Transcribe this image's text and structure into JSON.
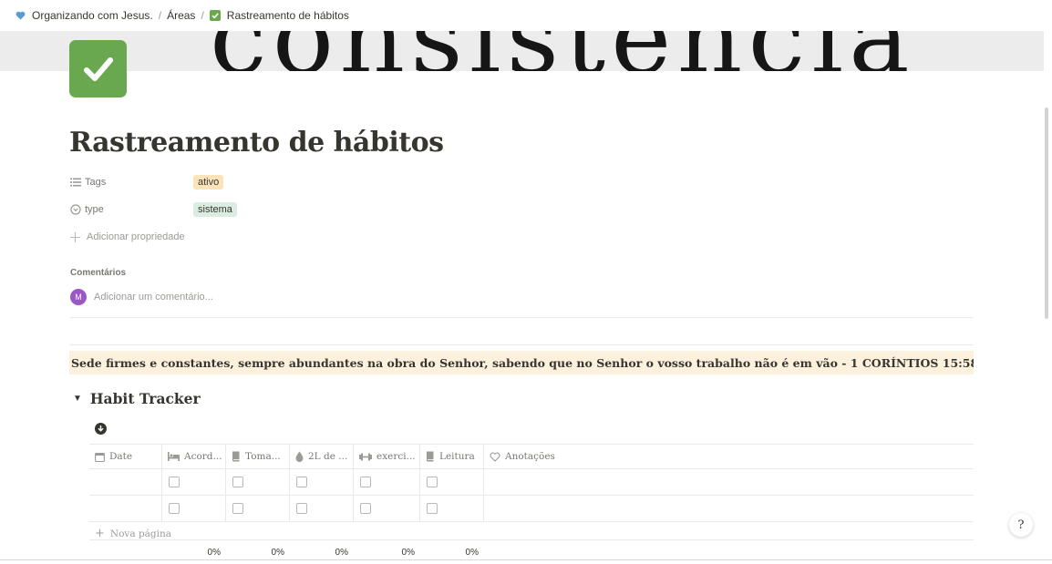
{
  "breadcrumb": {
    "items": [
      {
        "label": "Organizando com Jesus.",
        "icon": "blue-heart-icon"
      },
      {
        "label": "Áreas",
        "icon": ""
      },
      {
        "label": "Rastreamento de hábitos",
        "icon": "checkmark-box-icon"
      }
    ],
    "separator": "/"
  },
  "cover": {
    "text": "consistencia"
  },
  "page": {
    "icon": "green-checkmark-icon",
    "title": "Rastreamento de hábitos"
  },
  "properties": {
    "tags": {
      "label": "Tags",
      "value": "ativo",
      "icon": "list-icon"
    },
    "type": {
      "label": "type",
      "value": "sistema",
      "icon": "select-icon"
    },
    "add_property": "Adicionar propriedade"
  },
  "comments": {
    "label": "Comentários",
    "avatar_letter": "M",
    "placeholder": "Adicionar um comentário..."
  },
  "quote": "Sede firmes e constantes, sempre abundantes na obra do Senhor, sabendo que no Senhor o vosso trabalho não é em vão - 1 CORÍNTIOS 15:58.",
  "toggle": {
    "title": "Habit Tracker"
  },
  "table": {
    "columns": [
      {
        "label": "Date",
        "icon": "calendar-icon"
      },
      {
        "label": "Acord...",
        "icon": "bed-icon"
      },
      {
        "label": "Toma...",
        "icon": "book-icon"
      },
      {
        "label": "2L de ...",
        "icon": "water-drop-icon"
      },
      {
        "label": "exerci...",
        "icon": "dumbbell-icon"
      },
      {
        "label": "Leitura",
        "icon": "book-icon"
      },
      {
        "label": "Anotações",
        "icon": "heart-icon"
      }
    ],
    "new_page": "Nova página",
    "calculations": [
      "0%",
      "0%",
      "0%",
      "0%",
      "0%"
    ]
  },
  "help_button": "?"
}
